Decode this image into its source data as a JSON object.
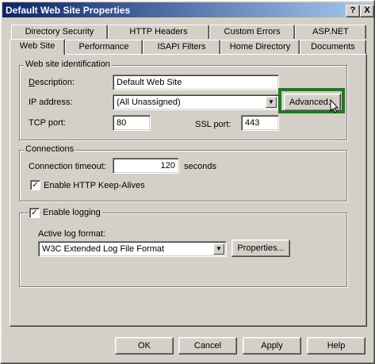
{
  "window": {
    "title": "Default Web Site Properties",
    "help_button": "?",
    "close_button": "X"
  },
  "tabs": {
    "row1": [
      "Directory Security",
      "HTTP Headers",
      "Custom Errors",
      "ASP.NET"
    ],
    "row2": [
      "Web Site",
      "Performance",
      "ISAPI Filters",
      "Home Directory",
      "Documents"
    ],
    "active": "Web Site"
  },
  "identification": {
    "legend": "Web site identification",
    "description_label": "Description:",
    "description_value": "Default Web Site",
    "ip_label": "IP address:",
    "ip_value": "(All Unassigned)",
    "advanced_button": "Advanced...",
    "tcp_label": "TCP port:",
    "tcp_value": "80",
    "ssl_label": "SSL port:",
    "ssl_value": "443"
  },
  "connections": {
    "legend": "Connections",
    "timeout_label": "Connection timeout:",
    "timeout_value": "120",
    "timeout_unit": "seconds",
    "keepalive_label": "Enable HTTP Keep-Alives",
    "keepalive_checked": true
  },
  "logging": {
    "enable_label": "Enable logging",
    "enable_checked": true,
    "format_label": "Active log format:",
    "format_value": "W3C Extended Log File Format",
    "properties_button": "Properties..."
  },
  "footer": {
    "ok": "OK",
    "cancel": "Cancel",
    "apply": "Apply",
    "help": "Help"
  },
  "colors": {
    "highlight": "#1f7a1f",
    "titlebar_start": "#0a246a",
    "titlebar_end": "#a6caf0",
    "face": "#d4d0c8"
  }
}
